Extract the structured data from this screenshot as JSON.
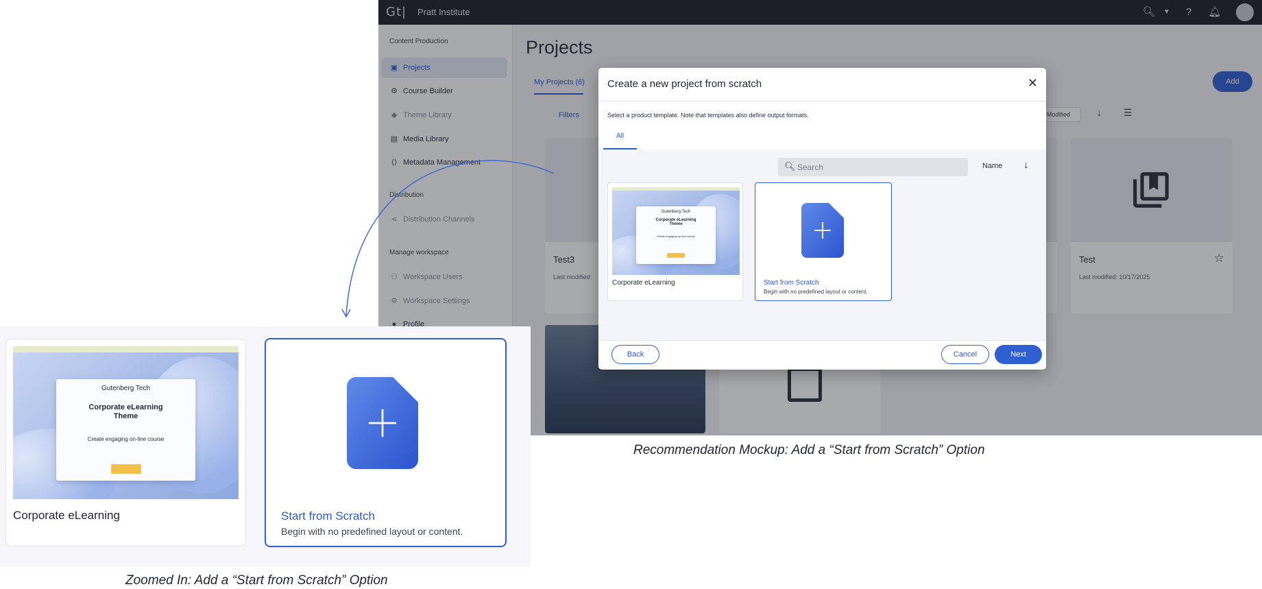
{
  "topbar": {
    "logo": "Gt|",
    "org": "Pratt Institute"
  },
  "sidebar": {
    "section_content": "Content Production",
    "items_content": [
      {
        "label": "Projects",
        "icon": "projects-icon"
      },
      {
        "label": "Course Builder",
        "icon": "course-builder-icon"
      },
      {
        "label": "Theme Library",
        "icon": "theme-library-icon"
      },
      {
        "label": "Media Library",
        "icon": "media-library-icon"
      },
      {
        "label": "Metadata Management",
        "icon": "metadata-icon"
      }
    ],
    "section_distribution": "Distribution",
    "items_distribution": [
      {
        "label": "Distribution Channels",
        "icon": "share-icon"
      }
    ],
    "section_workspace": "Manage workspace",
    "items_workspace": [
      {
        "label": "Workspace Users",
        "icon": "users-icon"
      },
      {
        "label": "Workspace Settings",
        "icon": "settings-icon"
      },
      {
        "label": "Profile",
        "icon": "profile-icon"
      }
    ]
  },
  "main": {
    "title": "Projects",
    "tab": "My Projects (6)",
    "add_label": "Add",
    "filters_label": "Filters",
    "sort_label": "Modified",
    "cards": [
      {
        "title": "Test3",
        "meta": "Last modified:"
      },
      {
        "title": "Test",
        "meta": "Last modified: 10/17/2025"
      }
    ]
  },
  "modal": {
    "title": "Create a new project from scratch",
    "description": "Select a product template. Note that templates also define output formats.",
    "tab_all": "All",
    "search_placeholder": "Search",
    "sort_label": "Name",
    "templates": [
      {
        "name": "Corporate eLearning"
      },
      {
        "name": "Start from Scratch",
        "subtitle": "Begin with no predefined layout or content."
      }
    ],
    "back": "Back",
    "cancel": "Cancel",
    "next": "Next"
  },
  "thumbnail": {
    "brand": "Gutenberg Tech",
    "headline": "Corporate eLearning Theme",
    "tagline": "Create engaging on-line course"
  },
  "zoom": {
    "card1_name": "Corporate eLearning",
    "card2_name": "Start from Scratch",
    "card2_subtitle": "Begin with no predefined layout or content."
  },
  "captions": {
    "mockup": "Recommendation Mockup: Add a “Start from Scratch” Option",
    "zoom": "Zoomed In: Add a “Start from Scratch” Option"
  },
  "colors": {
    "accent": "#2f5fd0",
    "topbar": "#1d2129",
    "overlay": "rgba(25,28,38,0.38)"
  }
}
